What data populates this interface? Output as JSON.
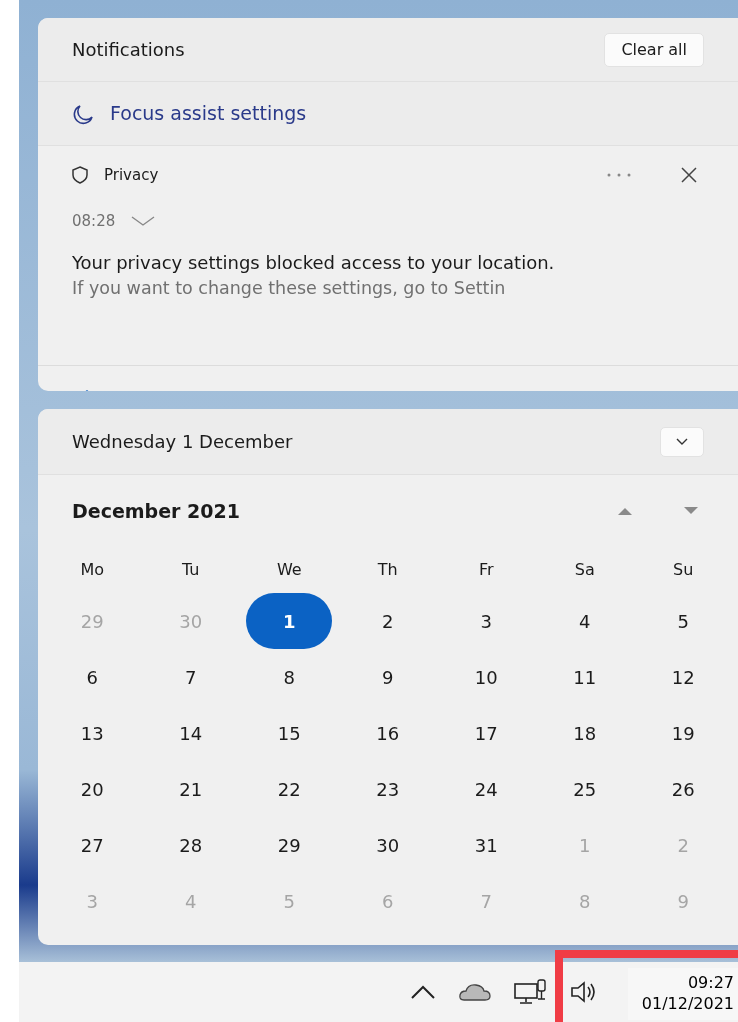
{
  "notifications": {
    "title": "Notifications",
    "clear_button": "Clear all",
    "focus_assist": "Focus assist settings",
    "items": [
      {
        "app": "Privacy",
        "time": "08:28",
        "title": "Your privacy settings blocked access to your location.",
        "body": "If you want to change these settings, go to Settin"
      }
    ]
  },
  "calendar": {
    "date_heading": "Wednesday 1 December",
    "month": "December 2021",
    "weekdays": [
      "Mo",
      "Tu",
      "We",
      "Th",
      "Fr",
      "Sa",
      "Su"
    ],
    "weeks": [
      [
        {
          "day": "29",
          "in_month": false,
          "selected": false
        },
        {
          "day": "30",
          "in_month": false,
          "selected": false
        },
        {
          "day": "1",
          "in_month": true,
          "selected": true
        },
        {
          "day": "2",
          "in_month": true,
          "selected": false
        },
        {
          "day": "3",
          "in_month": true,
          "selected": false
        },
        {
          "day": "4",
          "in_month": true,
          "selected": false
        },
        {
          "day": "5",
          "in_month": true,
          "selected": false
        }
      ],
      [
        {
          "day": "6",
          "in_month": true,
          "selected": false
        },
        {
          "day": "7",
          "in_month": true,
          "selected": false
        },
        {
          "day": "8",
          "in_month": true,
          "selected": false
        },
        {
          "day": "9",
          "in_month": true,
          "selected": false
        },
        {
          "day": "10",
          "in_month": true,
          "selected": false
        },
        {
          "day": "11",
          "in_month": true,
          "selected": false
        },
        {
          "day": "12",
          "in_month": true,
          "selected": false
        }
      ],
      [
        {
          "day": "13",
          "in_month": true,
          "selected": false
        },
        {
          "day": "14",
          "in_month": true,
          "selected": false
        },
        {
          "day": "15",
          "in_month": true,
          "selected": false
        },
        {
          "day": "16",
          "in_month": true,
          "selected": false
        },
        {
          "day": "17",
          "in_month": true,
          "selected": false
        },
        {
          "day": "18",
          "in_month": true,
          "selected": false
        },
        {
          "day": "19",
          "in_month": true,
          "selected": false
        }
      ],
      [
        {
          "day": "20",
          "in_month": true,
          "selected": false
        },
        {
          "day": "21",
          "in_month": true,
          "selected": false
        },
        {
          "day": "22",
          "in_month": true,
          "selected": false
        },
        {
          "day": "23",
          "in_month": true,
          "selected": false
        },
        {
          "day": "24",
          "in_month": true,
          "selected": false
        },
        {
          "day": "25",
          "in_month": true,
          "selected": false
        },
        {
          "day": "26",
          "in_month": true,
          "selected": false
        }
      ],
      [
        {
          "day": "27",
          "in_month": true,
          "selected": false
        },
        {
          "day": "28",
          "in_month": true,
          "selected": false
        },
        {
          "day": "29",
          "in_month": true,
          "selected": false
        },
        {
          "day": "30",
          "in_month": true,
          "selected": false
        },
        {
          "day": "31",
          "in_month": true,
          "selected": false
        },
        {
          "day": "1",
          "in_month": false,
          "selected": false
        },
        {
          "day": "2",
          "in_month": false,
          "selected": false
        }
      ],
      [
        {
          "day": "3",
          "in_month": false,
          "selected": false
        },
        {
          "day": "4",
          "in_month": false,
          "selected": false
        },
        {
          "day": "5",
          "in_month": false,
          "selected": false
        },
        {
          "day": "6",
          "in_month": false,
          "selected": false
        },
        {
          "day": "7",
          "in_month": false,
          "selected": false
        },
        {
          "day": "8",
          "in_month": false,
          "selected": false
        },
        {
          "day": "9",
          "in_month": false,
          "selected": false
        }
      ]
    ]
  },
  "taskbar": {
    "time": "09:27",
    "date": "01/12/2021",
    "highlighted": true
  }
}
